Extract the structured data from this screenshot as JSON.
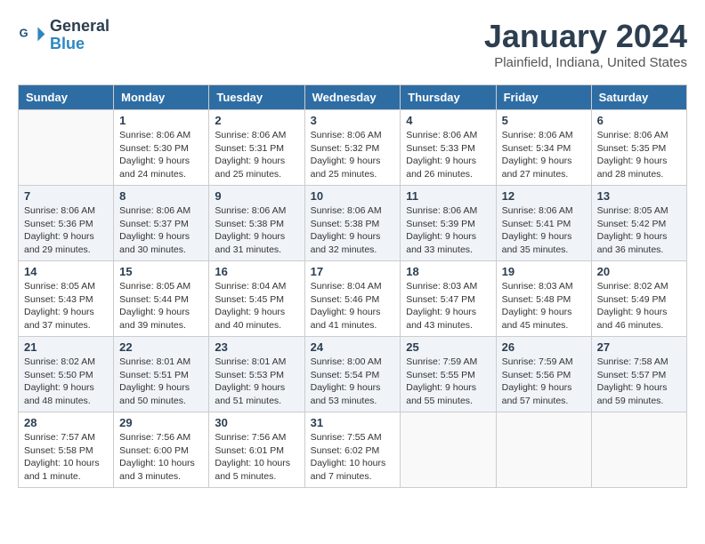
{
  "header": {
    "logo_line1": "General",
    "logo_line2": "Blue",
    "month": "January 2024",
    "location": "Plainfield, Indiana, United States"
  },
  "weekdays": [
    "Sunday",
    "Monday",
    "Tuesday",
    "Wednesday",
    "Thursday",
    "Friday",
    "Saturday"
  ],
  "weeks": [
    [
      {
        "day": "",
        "info": ""
      },
      {
        "day": "1",
        "info": "Sunrise: 8:06 AM\nSunset: 5:30 PM\nDaylight: 9 hours\nand 24 minutes."
      },
      {
        "day": "2",
        "info": "Sunrise: 8:06 AM\nSunset: 5:31 PM\nDaylight: 9 hours\nand 25 minutes."
      },
      {
        "day": "3",
        "info": "Sunrise: 8:06 AM\nSunset: 5:32 PM\nDaylight: 9 hours\nand 25 minutes."
      },
      {
        "day": "4",
        "info": "Sunrise: 8:06 AM\nSunset: 5:33 PM\nDaylight: 9 hours\nand 26 minutes."
      },
      {
        "day": "5",
        "info": "Sunrise: 8:06 AM\nSunset: 5:34 PM\nDaylight: 9 hours\nand 27 minutes."
      },
      {
        "day": "6",
        "info": "Sunrise: 8:06 AM\nSunset: 5:35 PM\nDaylight: 9 hours\nand 28 minutes."
      }
    ],
    [
      {
        "day": "7",
        "info": "Sunrise: 8:06 AM\nSunset: 5:36 PM\nDaylight: 9 hours\nand 29 minutes."
      },
      {
        "day": "8",
        "info": "Sunrise: 8:06 AM\nSunset: 5:37 PM\nDaylight: 9 hours\nand 30 minutes."
      },
      {
        "day": "9",
        "info": "Sunrise: 8:06 AM\nSunset: 5:38 PM\nDaylight: 9 hours\nand 31 minutes."
      },
      {
        "day": "10",
        "info": "Sunrise: 8:06 AM\nSunset: 5:38 PM\nDaylight: 9 hours\nand 32 minutes."
      },
      {
        "day": "11",
        "info": "Sunrise: 8:06 AM\nSunset: 5:39 PM\nDaylight: 9 hours\nand 33 minutes."
      },
      {
        "day": "12",
        "info": "Sunrise: 8:06 AM\nSunset: 5:41 PM\nDaylight: 9 hours\nand 35 minutes."
      },
      {
        "day": "13",
        "info": "Sunrise: 8:05 AM\nSunset: 5:42 PM\nDaylight: 9 hours\nand 36 minutes."
      }
    ],
    [
      {
        "day": "14",
        "info": "Sunrise: 8:05 AM\nSunset: 5:43 PM\nDaylight: 9 hours\nand 37 minutes."
      },
      {
        "day": "15",
        "info": "Sunrise: 8:05 AM\nSunset: 5:44 PM\nDaylight: 9 hours\nand 39 minutes."
      },
      {
        "day": "16",
        "info": "Sunrise: 8:04 AM\nSunset: 5:45 PM\nDaylight: 9 hours\nand 40 minutes."
      },
      {
        "day": "17",
        "info": "Sunrise: 8:04 AM\nSunset: 5:46 PM\nDaylight: 9 hours\nand 41 minutes."
      },
      {
        "day": "18",
        "info": "Sunrise: 8:03 AM\nSunset: 5:47 PM\nDaylight: 9 hours\nand 43 minutes."
      },
      {
        "day": "19",
        "info": "Sunrise: 8:03 AM\nSunset: 5:48 PM\nDaylight: 9 hours\nand 45 minutes."
      },
      {
        "day": "20",
        "info": "Sunrise: 8:02 AM\nSunset: 5:49 PM\nDaylight: 9 hours\nand 46 minutes."
      }
    ],
    [
      {
        "day": "21",
        "info": "Sunrise: 8:02 AM\nSunset: 5:50 PM\nDaylight: 9 hours\nand 48 minutes."
      },
      {
        "day": "22",
        "info": "Sunrise: 8:01 AM\nSunset: 5:51 PM\nDaylight: 9 hours\nand 50 minutes."
      },
      {
        "day": "23",
        "info": "Sunrise: 8:01 AM\nSunset: 5:53 PM\nDaylight: 9 hours\nand 51 minutes."
      },
      {
        "day": "24",
        "info": "Sunrise: 8:00 AM\nSunset: 5:54 PM\nDaylight: 9 hours\nand 53 minutes."
      },
      {
        "day": "25",
        "info": "Sunrise: 7:59 AM\nSunset: 5:55 PM\nDaylight: 9 hours\nand 55 minutes."
      },
      {
        "day": "26",
        "info": "Sunrise: 7:59 AM\nSunset: 5:56 PM\nDaylight: 9 hours\nand 57 minutes."
      },
      {
        "day": "27",
        "info": "Sunrise: 7:58 AM\nSunset: 5:57 PM\nDaylight: 9 hours\nand 59 minutes."
      }
    ],
    [
      {
        "day": "28",
        "info": "Sunrise: 7:57 AM\nSunset: 5:58 PM\nDaylight: 10 hours\nand 1 minute."
      },
      {
        "day": "29",
        "info": "Sunrise: 7:56 AM\nSunset: 6:00 PM\nDaylight: 10 hours\nand 3 minutes."
      },
      {
        "day": "30",
        "info": "Sunrise: 7:56 AM\nSunset: 6:01 PM\nDaylight: 10 hours\nand 5 minutes."
      },
      {
        "day": "31",
        "info": "Sunrise: 7:55 AM\nSunset: 6:02 PM\nDaylight: 10 hours\nand 7 minutes."
      },
      {
        "day": "",
        "info": ""
      },
      {
        "day": "",
        "info": ""
      },
      {
        "day": "",
        "info": ""
      }
    ]
  ]
}
